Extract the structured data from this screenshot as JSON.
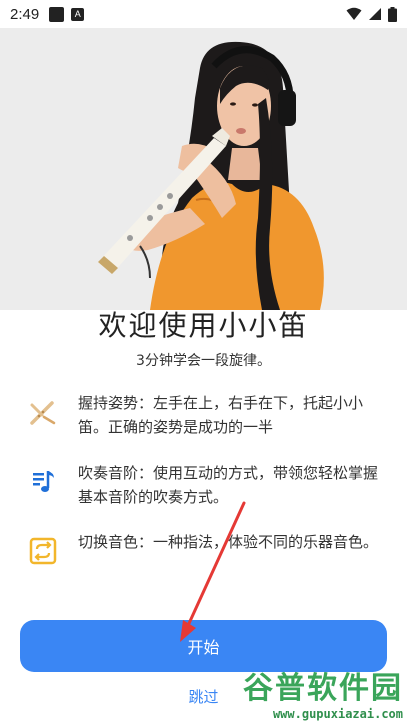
{
  "status_bar": {
    "time": "2:49",
    "notif_icons": [
      "square-notification-icon",
      "a-notification-icon"
    ],
    "system_icons": [
      "wifi-icon",
      "signal-icon",
      "battery-icon"
    ]
  },
  "hero": {
    "image": "woman-playing-electronic-flute-photo"
  },
  "main": {
    "title": "欢迎使用小小笛",
    "subtitle": "3分钟学会一段旋律。"
  },
  "features": [
    {
      "icon": "flute-posture-icon",
      "text": "握持姿势：左手在上，右手在下，托起小小笛。正确的姿势是成功的一半"
    },
    {
      "icon": "music-note-icon",
      "text": "吹奏音阶：使用互动的方式，带领您轻松掌握基本音阶的吹奏方式。"
    },
    {
      "icon": "switch-tone-icon",
      "text": "切换音色：一种指法，体验不同的乐器音色。"
    }
  ],
  "actions": {
    "start_label": "开始",
    "skip_label": "跳过"
  },
  "watermark": {
    "title": "谷普软件园",
    "url": "www.gupuxiazai.com"
  },
  "colors": {
    "accent": "#3a86f4",
    "posture_icon": "#e3c08f",
    "music_icon": "#1f6fd8",
    "switch_icon": "#f2b62b",
    "annotation": "#e53935",
    "watermark": "#3aa55a"
  }
}
